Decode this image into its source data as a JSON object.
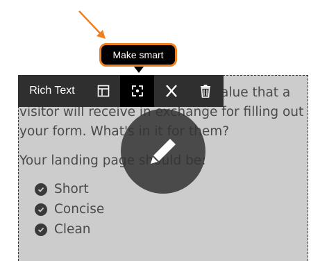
{
  "tooltip": {
    "text": "Make smart"
  },
  "toolbar": {
    "label": "Rich Text",
    "buttons": [
      {
        "icon": "layout-icon"
      },
      {
        "icon": "make-smart-icon",
        "active": true
      },
      {
        "icon": "cut-icon"
      },
      {
        "icon": "trash-icon"
      }
    ]
  },
  "content": {
    "paragraph1": "alue that a visitor will receive in exchange for filling out your form. What's in it for them?",
    "paragraph2": "Your landing page should be:",
    "list": [
      "Short",
      "Concise",
      "Clean"
    ]
  },
  "colors": {
    "accent": "#f07f22",
    "toolbar_bg": "#2f2f2f",
    "module_bg": "#cccccc"
  }
}
